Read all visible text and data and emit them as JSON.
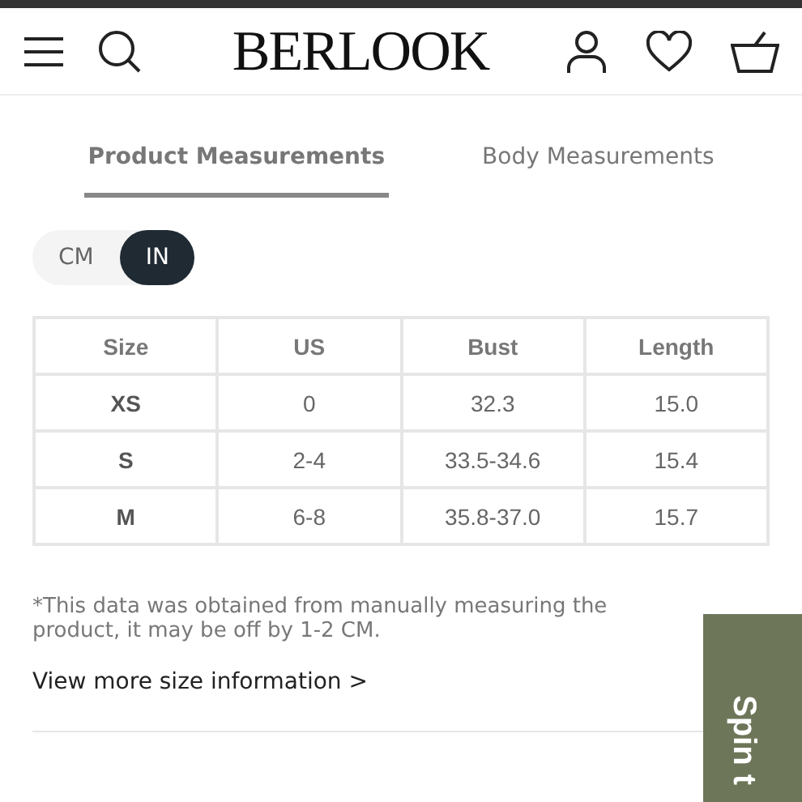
{
  "header": {
    "logo": "BERLOOK"
  },
  "tabs": [
    {
      "label": "Product Measurements",
      "selected": true
    },
    {
      "label": "Body Measurements",
      "selected": false
    }
  ],
  "units": [
    {
      "label": "CM",
      "selected": false
    },
    {
      "label": "IN",
      "selected": true
    }
  ],
  "table": {
    "columns": [
      "Size",
      "US",
      "Bust",
      "Length"
    ],
    "rows": [
      [
        "XS",
        "0",
        "32.3",
        "15.0"
      ],
      [
        "S",
        "2-4",
        "33.5-34.6",
        "15.4"
      ],
      [
        "M",
        "6-8",
        "35.8-37.0",
        "15.7"
      ]
    ]
  },
  "note": "*This data was obtained from manually measuring the product, it may be off by 1-2 CM.",
  "more_link": "View more size information >",
  "side_tab": {
    "label": "Spin t"
  }
}
